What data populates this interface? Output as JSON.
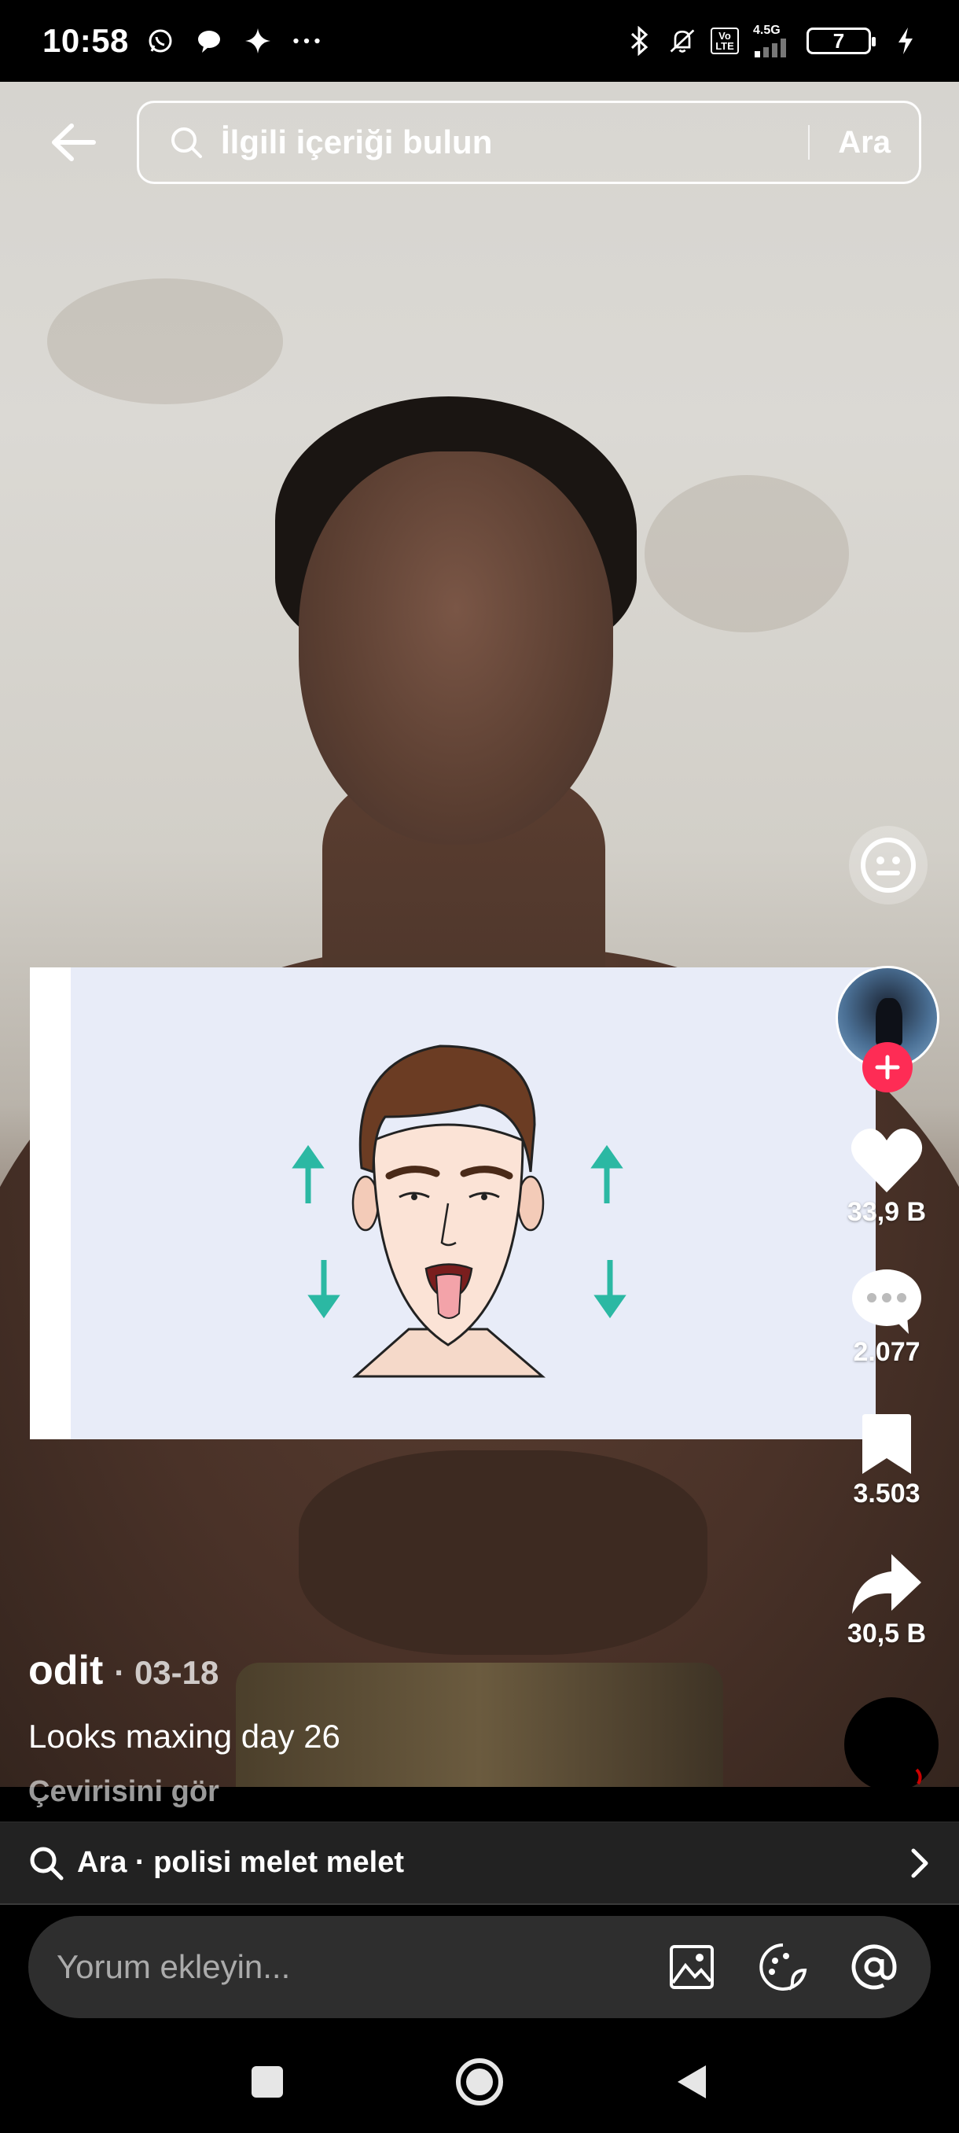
{
  "status_bar": {
    "time": "10:58",
    "network_label": "4.5G",
    "volte_label": "Vo LTE",
    "battery_level": "7"
  },
  "search": {
    "placeholder": "İlgili içeriği bulun",
    "submit_label": "Ara"
  },
  "actions": {
    "likes": "33,9 B",
    "comments": "2.077",
    "saves": "3.503",
    "shares": "30,5 B"
  },
  "post": {
    "username": "odit",
    "date": "· 03-18",
    "caption": "Looks maxing day 26",
    "see_translation": "Çevirisini gör"
  },
  "suggestion": {
    "text": "Ara · polisi melet melet"
  },
  "comment": {
    "placeholder": "Yorum ekleyin..."
  },
  "colors": {
    "accent": "#fe2c55",
    "arrow_teal": "#2bb8a3",
    "illustration_bg": "#e8ecf8"
  }
}
